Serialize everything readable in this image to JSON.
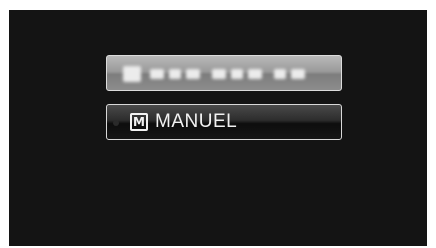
{
  "menu": {
    "items": [
      {
        "label": "",
        "state": "blurred"
      },
      {
        "icon": "manual-mode-icon",
        "icon_text": "M",
        "label": "MANUEL",
        "state": "selected"
      }
    ]
  },
  "colors": {
    "screen_background": "#141414",
    "selected_item_background": "#1f1f1f",
    "blurred_item_background": "#9a9a9a",
    "text": "#f2f2f2"
  }
}
